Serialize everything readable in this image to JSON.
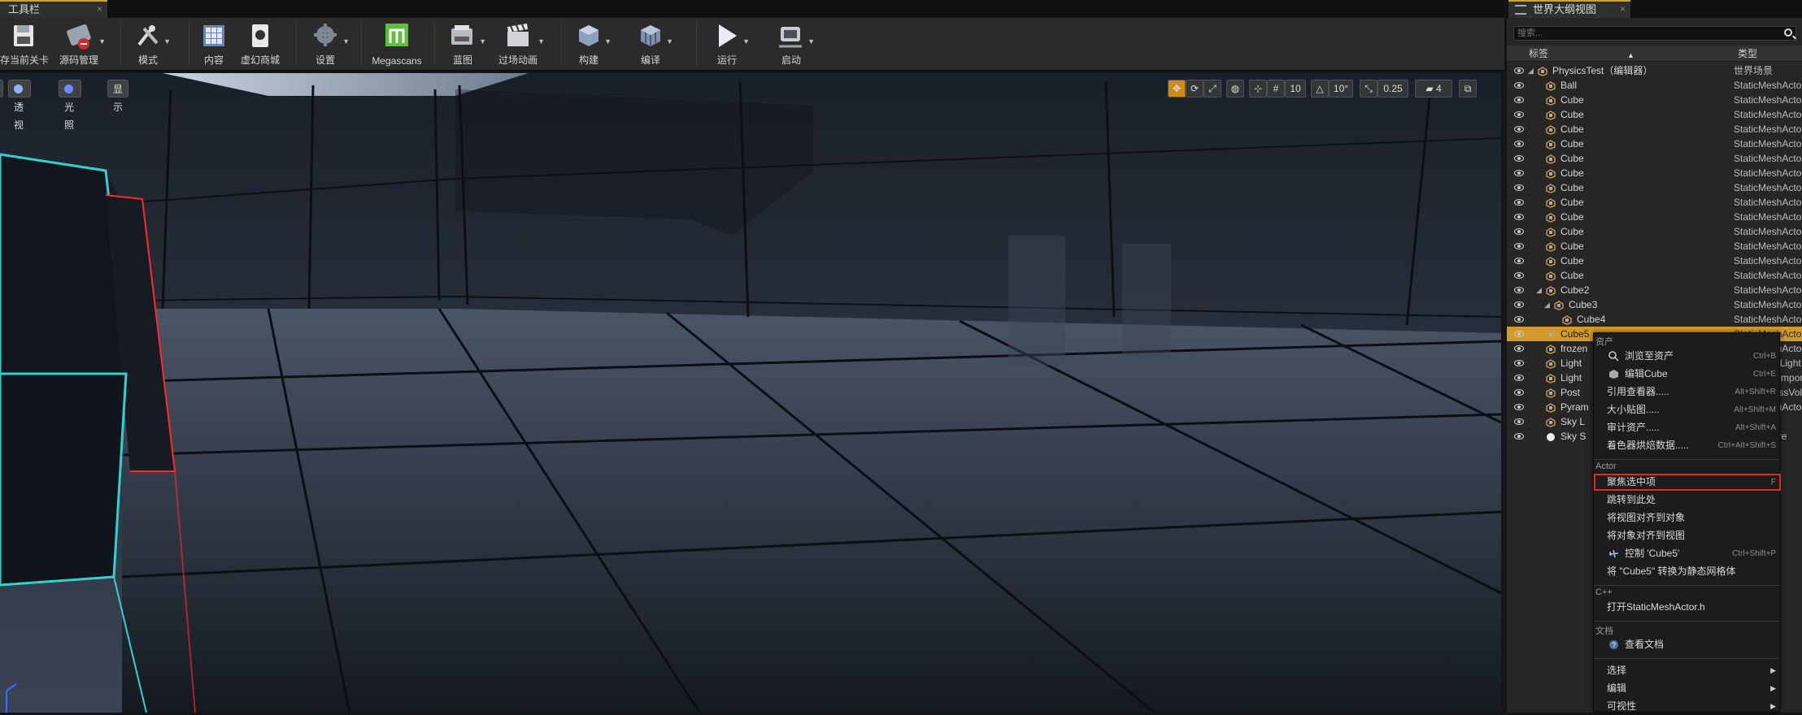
{
  "toolbar_panel": {
    "tab_title": "工具栏",
    "buttons": [
      {
        "label": "存当前关卡",
        "icon": "save-icon"
      },
      {
        "label": "源码管理",
        "icon": "source-control-icon"
      },
      {
        "label": "模式",
        "icon": "modes-icon"
      },
      {
        "label": "内容",
        "icon": "content-icon"
      },
      {
        "label": "虚幻商城",
        "icon": "marketplace-icon"
      },
      {
        "label": "设置",
        "icon": "settings-icon"
      },
      {
        "label": "Megascans",
        "icon": "megascans-icon"
      },
      {
        "label": "蓝图",
        "icon": "blueprint-icon"
      },
      {
        "label": "过场动画",
        "icon": "cinematics-icon"
      },
      {
        "label": "构建",
        "icon": "build-icon"
      },
      {
        "label": "编译",
        "icon": "compile-icon"
      },
      {
        "label": "运行",
        "icon": "play-icon"
      },
      {
        "label": "启动",
        "icon": "launch-icon"
      }
    ]
  },
  "viewport": {
    "view_mode_perspective": "透视",
    "view_mode_lit": "光照",
    "show": "显示",
    "grid_snap": "10",
    "rotation_snap": "10°",
    "scale_snap": "0.25",
    "camera_speed": "4"
  },
  "outliner": {
    "tab_title": "世界大纲视图",
    "search_placeholder": "搜索...",
    "col_label": "标签",
    "col_type": "类型",
    "rows": [
      {
        "name": "PhysicsTest（编辑器）",
        "type": "世界场景"
      },
      {
        "name": "Ball",
        "type": "StaticMeshActor"
      },
      {
        "name": "Cube",
        "type": "StaticMeshActor"
      },
      {
        "name": "Cube",
        "type": "StaticMeshActor"
      },
      {
        "name": "Cube",
        "type": "StaticMeshActor"
      },
      {
        "name": "Cube",
        "type": "StaticMeshActor"
      },
      {
        "name": "Cube",
        "type": "StaticMeshActor"
      },
      {
        "name": "Cube",
        "type": "StaticMeshActor"
      },
      {
        "name": "Cube",
        "type": "StaticMeshActor"
      },
      {
        "name": "Cube",
        "type": "StaticMeshActor"
      },
      {
        "name": "Cube",
        "type": "StaticMeshActor"
      },
      {
        "name": "Cube",
        "type": "StaticMeshActor"
      },
      {
        "name": "Cube",
        "type": "StaticMeshActor"
      },
      {
        "name": "Cube",
        "type": "StaticMeshActor"
      },
      {
        "name": "Cube",
        "type": "StaticMeshActor"
      },
      {
        "name": "Cube2",
        "type": "StaticMeshActor"
      },
      {
        "name": "Cube3",
        "type": "StaticMeshActor"
      },
      {
        "name": "Cube4",
        "type": "StaticMeshActor"
      },
      {
        "name": "Cube5",
        "type": "StaticMeshActor"
      },
      {
        "name": "frozen",
        "type": "StaticMeshActor"
      },
      {
        "name": "Light",
        "type": "DirectionalLight"
      },
      {
        "name": "Light",
        "type": "LightmassImportanceVolume"
      },
      {
        "name": "Post",
        "type": "PostProcessVolume"
      },
      {
        "name": "Pyram",
        "type": "StaticMeshActor"
      },
      {
        "name": "Sky L",
        "type": "SkyLight"
      },
      {
        "name": "Sky S",
        "type": "Sky_Sphere"
      }
    ]
  },
  "context_menu": {
    "sec_asset": "资产",
    "browse_asset": "浏览至资产",
    "browse_asset_sc": "Ctrl+B",
    "edit_cube": "编辑Cube",
    "edit_cube_sc": "Ctrl+E",
    "ref_viewer": "引用查看器.....",
    "ref_viewer_sc": "Alt+Shift+R",
    "size_map": "大小贴图.....",
    "size_map_sc": "Alt+Shift+M",
    "audit_assets": "审计资产.....",
    "audit_assets_sc": "Alt+Shift+A",
    "shader_cook": "着色器烘焙数据.....",
    "shader_cook_sc": "Ctrl+Alt+Shift+S",
    "sec_actor": "Actor",
    "focus_selected": "聚焦选中项",
    "focus_selected_sc": "F",
    "goto_here": "跳转到此处",
    "snap_view_to_object": "将视图对齐到对象",
    "snap_object_to_view": "将对象对齐到视图",
    "pilot": "控制 'Cube5'",
    "pilot_sc": "Ctrl+Shift+P",
    "convert": "将 \"Cube5\" 转换为静态网格体",
    "sec_cpp": "C++",
    "open_header": "打开StaticMeshActor.h",
    "sec_docs": "文档",
    "view_docs": "查看文档",
    "select": "选择",
    "edit": "编辑",
    "visibility": "可视性"
  }
}
